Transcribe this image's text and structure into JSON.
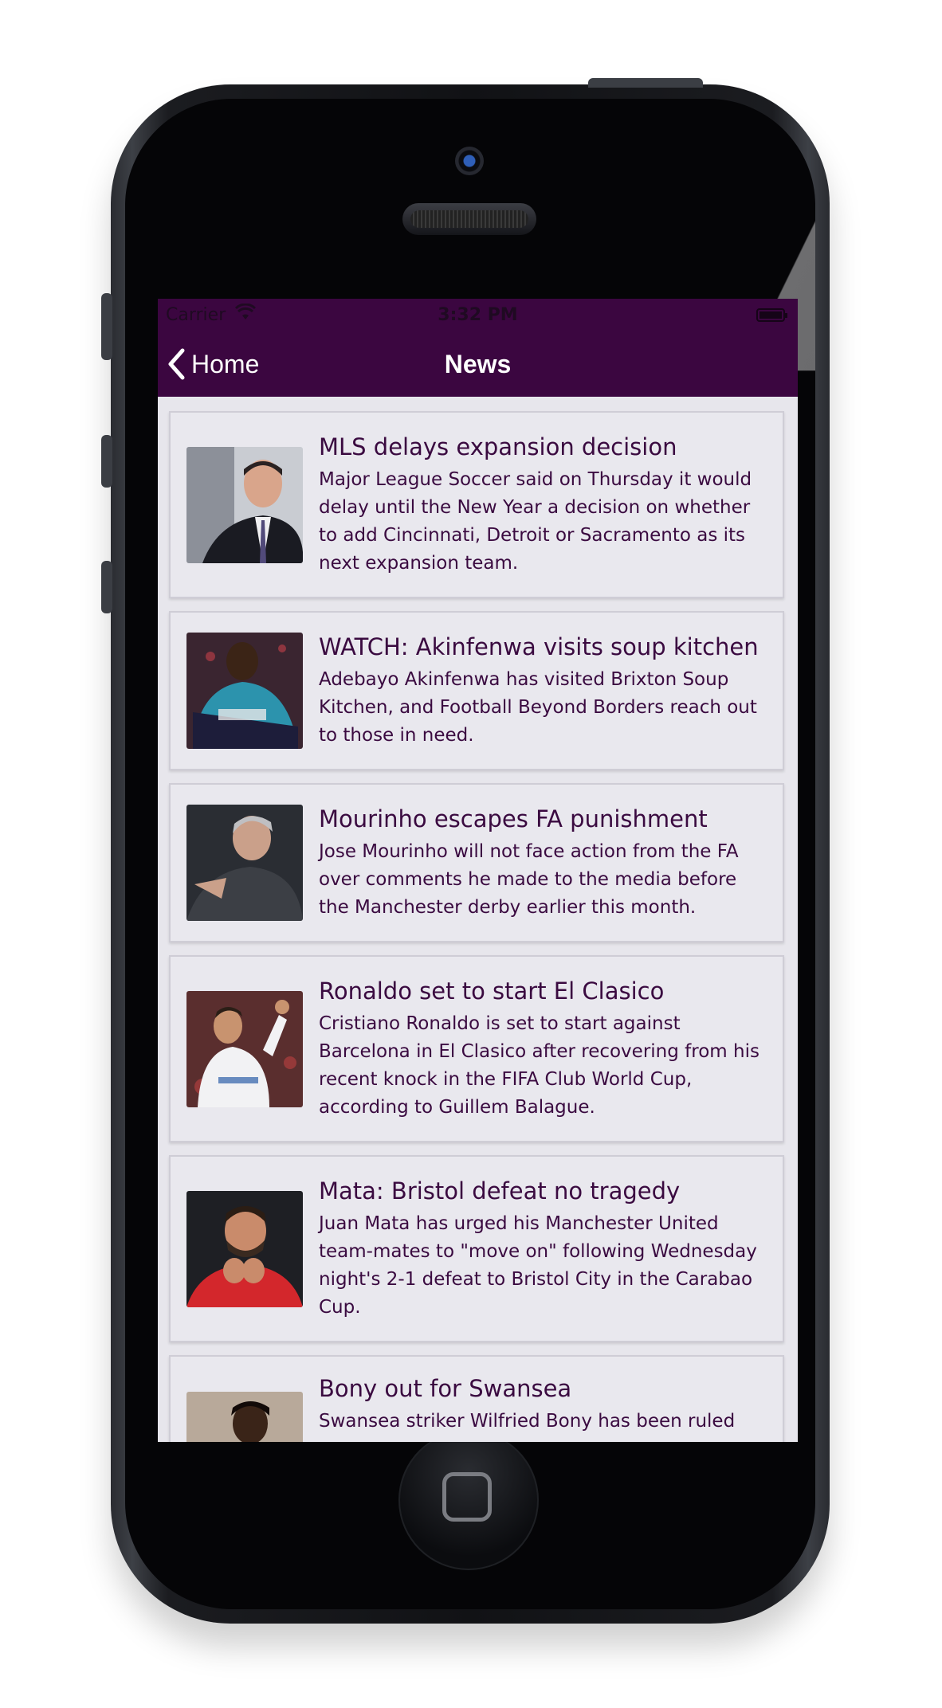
{
  "status_bar": {
    "carrier": "Carrier",
    "time": "3:32 PM"
  },
  "nav": {
    "back_label": "Home",
    "title": "News"
  },
  "colors": {
    "brand": "#3b0640",
    "text": "#3a0a40",
    "card_bg": "#e9e8ee",
    "screen_bg": "#e7e6ec"
  },
  "articles": [
    {
      "headline": "MLS delays expansion decision",
      "summary": "Major League Soccer said on Thursday it would delay until the New Year a decision on whether to add Cincinnati, Detroit or Sacramento as its next expansion team.",
      "thumb_icon": "man-in-suit-photo"
    },
    {
      "headline": "WATCH: Akinfenwa visits soup kitchen",
      "summary": "Adebayo Akinfenwa has visited Brixton Soup Kitchen, and Football Beyond Borders reach out to those in need.",
      "thumb_icon": "player-in-blue-kit-photo"
    },
    {
      "headline": "Mourinho escapes FA punishment",
      "summary": "Jose Mourinho will not face action from the FA over comments he made to the media before the Manchester derby earlier this month.",
      "thumb_icon": "manager-photo"
    },
    {
      "headline": "Ronaldo set to start El Clasico",
      "summary": "Cristiano Ronaldo is set to start against Barcelona in El Clasico after recovering from his recent knock in the FIFA Club World Cup, according to Guillem Balague.",
      "thumb_icon": "player-in-white-kit-photo"
    },
    {
      "headline": "Mata: Bristol defeat no tragedy",
      "summary": "Juan Mata has urged his Manchester United team-mates to \"move on\" following Wednesday night's 2-1 defeat to Bristol City in the Carabao Cup.",
      "thumb_icon": "player-in-red-kit-photo"
    },
    {
      "headline": "Bony out for Swansea",
      "summary": "Swansea striker Wilfried Bony has been ruled",
      "thumb_icon": "player-photo"
    }
  ]
}
